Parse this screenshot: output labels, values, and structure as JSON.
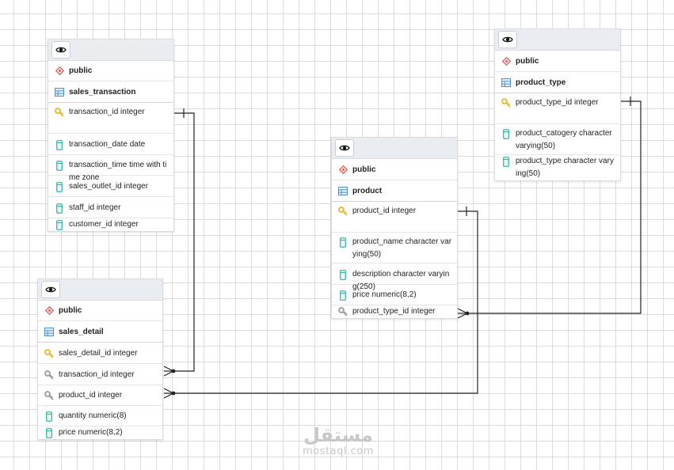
{
  "diagram": {
    "tables": [
      {
        "id": "sales_transaction",
        "schema": "public",
        "name": "sales_transaction",
        "columns": [
          {
            "label": "transaction_id integer",
            "kind": "pk"
          },
          {
            "label": "transaction_date date",
            "kind": "col"
          },
          {
            "label": "transaction_time time with time zone",
            "kind": "col"
          },
          {
            "label": "sales_outlet_id integer",
            "kind": "col"
          },
          {
            "label": "staff_id integer",
            "kind": "col"
          },
          {
            "label": "customer_id integer",
            "kind": "col"
          }
        ]
      },
      {
        "id": "sales_detail",
        "schema": "public",
        "name": "sales_detail",
        "columns": [
          {
            "label": "sales_detail_id integer",
            "kind": "pk"
          },
          {
            "label": "transaction_id integer",
            "kind": "fk"
          },
          {
            "label": "product_id integer",
            "kind": "fk"
          },
          {
            "label": "quantity numeric(8)",
            "kind": "col"
          },
          {
            "label": "price numeric(8,2)",
            "kind": "col"
          }
        ]
      },
      {
        "id": "product",
        "schema": "public",
        "name": "product",
        "columns": [
          {
            "label": "product_id integer",
            "kind": "pk"
          },
          {
            "label": "product_name character varying(50)",
            "kind": "col"
          },
          {
            "label": "description  character varying(250)",
            "kind": "col"
          },
          {
            "label": "price numeric(8,2)",
            "kind": "col"
          },
          {
            "label": "product_type_id integer",
            "kind": "fk"
          }
        ]
      },
      {
        "id": "product_type",
        "schema": "public",
        "name": "product_type",
        "columns": [
          {
            "label": "product_type_id integer",
            "kind": "pk"
          },
          {
            "label": "product_catogery character varying(50)",
            "kind": "col"
          },
          {
            "label": "product_type character varying(50)",
            "kind": "col"
          }
        ]
      }
    ],
    "relationships": [
      {
        "from": "sales_detail.transaction_id",
        "to": "sales_transaction.transaction_id",
        "cardinality": "many-to-one"
      },
      {
        "from": "sales_detail.product_id",
        "to": "product.product_id",
        "cardinality": "many-to-one"
      },
      {
        "from": "product.product_type_id",
        "to": "product_type.product_type_id",
        "cardinality": "many-to-one"
      }
    ]
  },
  "icons": {
    "view": "eye-icon",
    "schema": "schema-diamond-icon",
    "table": "table-grid-icon",
    "primary_key": "primary-key-icon",
    "foreign_key": "foreign-key-icon",
    "column": "column-icon"
  },
  "colors": {
    "primary_key": "#e8b824",
    "foreign_key": "#9a9a9a",
    "column": "#2fb59a",
    "schema": "#d9534f",
    "table": "#4a90d9",
    "line": "#222222"
  },
  "watermark": {
    "logo": "مستقل",
    "text": "mostaql.com"
  }
}
